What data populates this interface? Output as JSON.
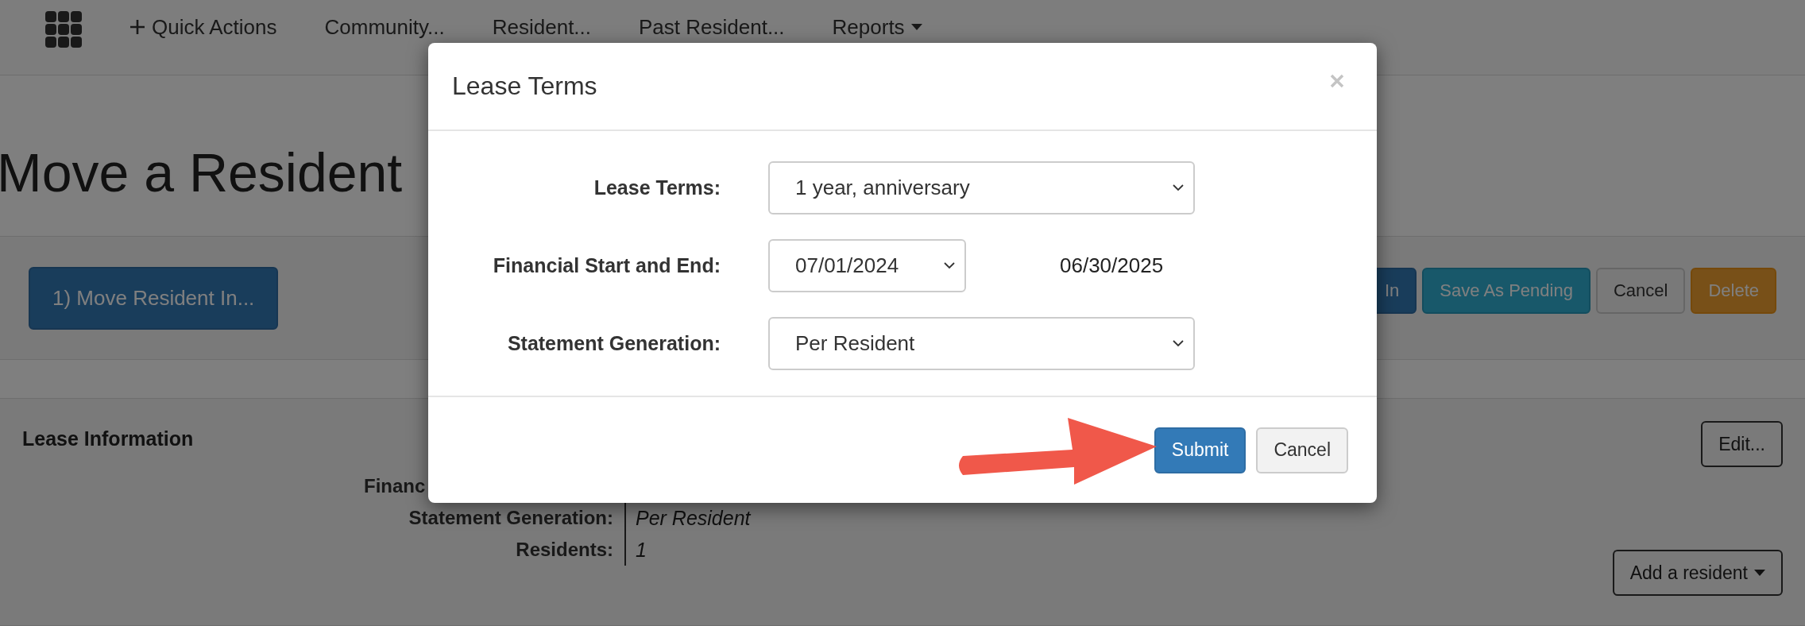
{
  "nav": {
    "items": [
      {
        "label": "Quick Actions",
        "kind": "action"
      },
      {
        "label": "Community...",
        "kind": "link"
      },
      {
        "label": "Resident...",
        "kind": "link"
      },
      {
        "label": "Past Resident...",
        "kind": "link"
      },
      {
        "label": "Reports",
        "kind": "dropdown"
      }
    ]
  },
  "page_title": "Move a Resident",
  "actions": {
    "primary": "1) Move Resident In...",
    "buttons": [
      {
        "label": "In",
        "kind": "primary"
      },
      {
        "label": "Save As Pending",
        "kind": "info"
      },
      {
        "label": "Cancel",
        "kind": "default"
      },
      {
        "label": "Delete",
        "kind": "warning"
      }
    ]
  },
  "lease_info": {
    "title": "Lease Information",
    "fields": [
      {
        "label": "Financ",
        "kind": "cut"
      },
      {
        "label": "Statement Generation:",
        "value": "Per Resident",
        "kind": "full"
      },
      {
        "label": "Residents:",
        "value": "1",
        "kind": "full"
      }
    ],
    "edit_button": "Edit...",
    "add_button": "Add a resident"
  },
  "dialog": {
    "title": "Lease Terms",
    "fields": [
      {
        "label": "Lease Terms:",
        "kind": "select",
        "value": "1 year, anniversary"
      },
      {
        "label": "Financial Start and End:",
        "kind": "range",
        "value": "07/01/2024",
        "end": "06/30/2025"
      },
      {
        "label": "Statement Generation:",
        "kind": "select",
        "value": "Per Resident"
      }
    ],
    "buttons": [
      {
        "label": "Submit",
        "kind": "primary"
      },
      {
        "label": "Cancel",
        "kind": "default"
      }
    ]
  }
}
